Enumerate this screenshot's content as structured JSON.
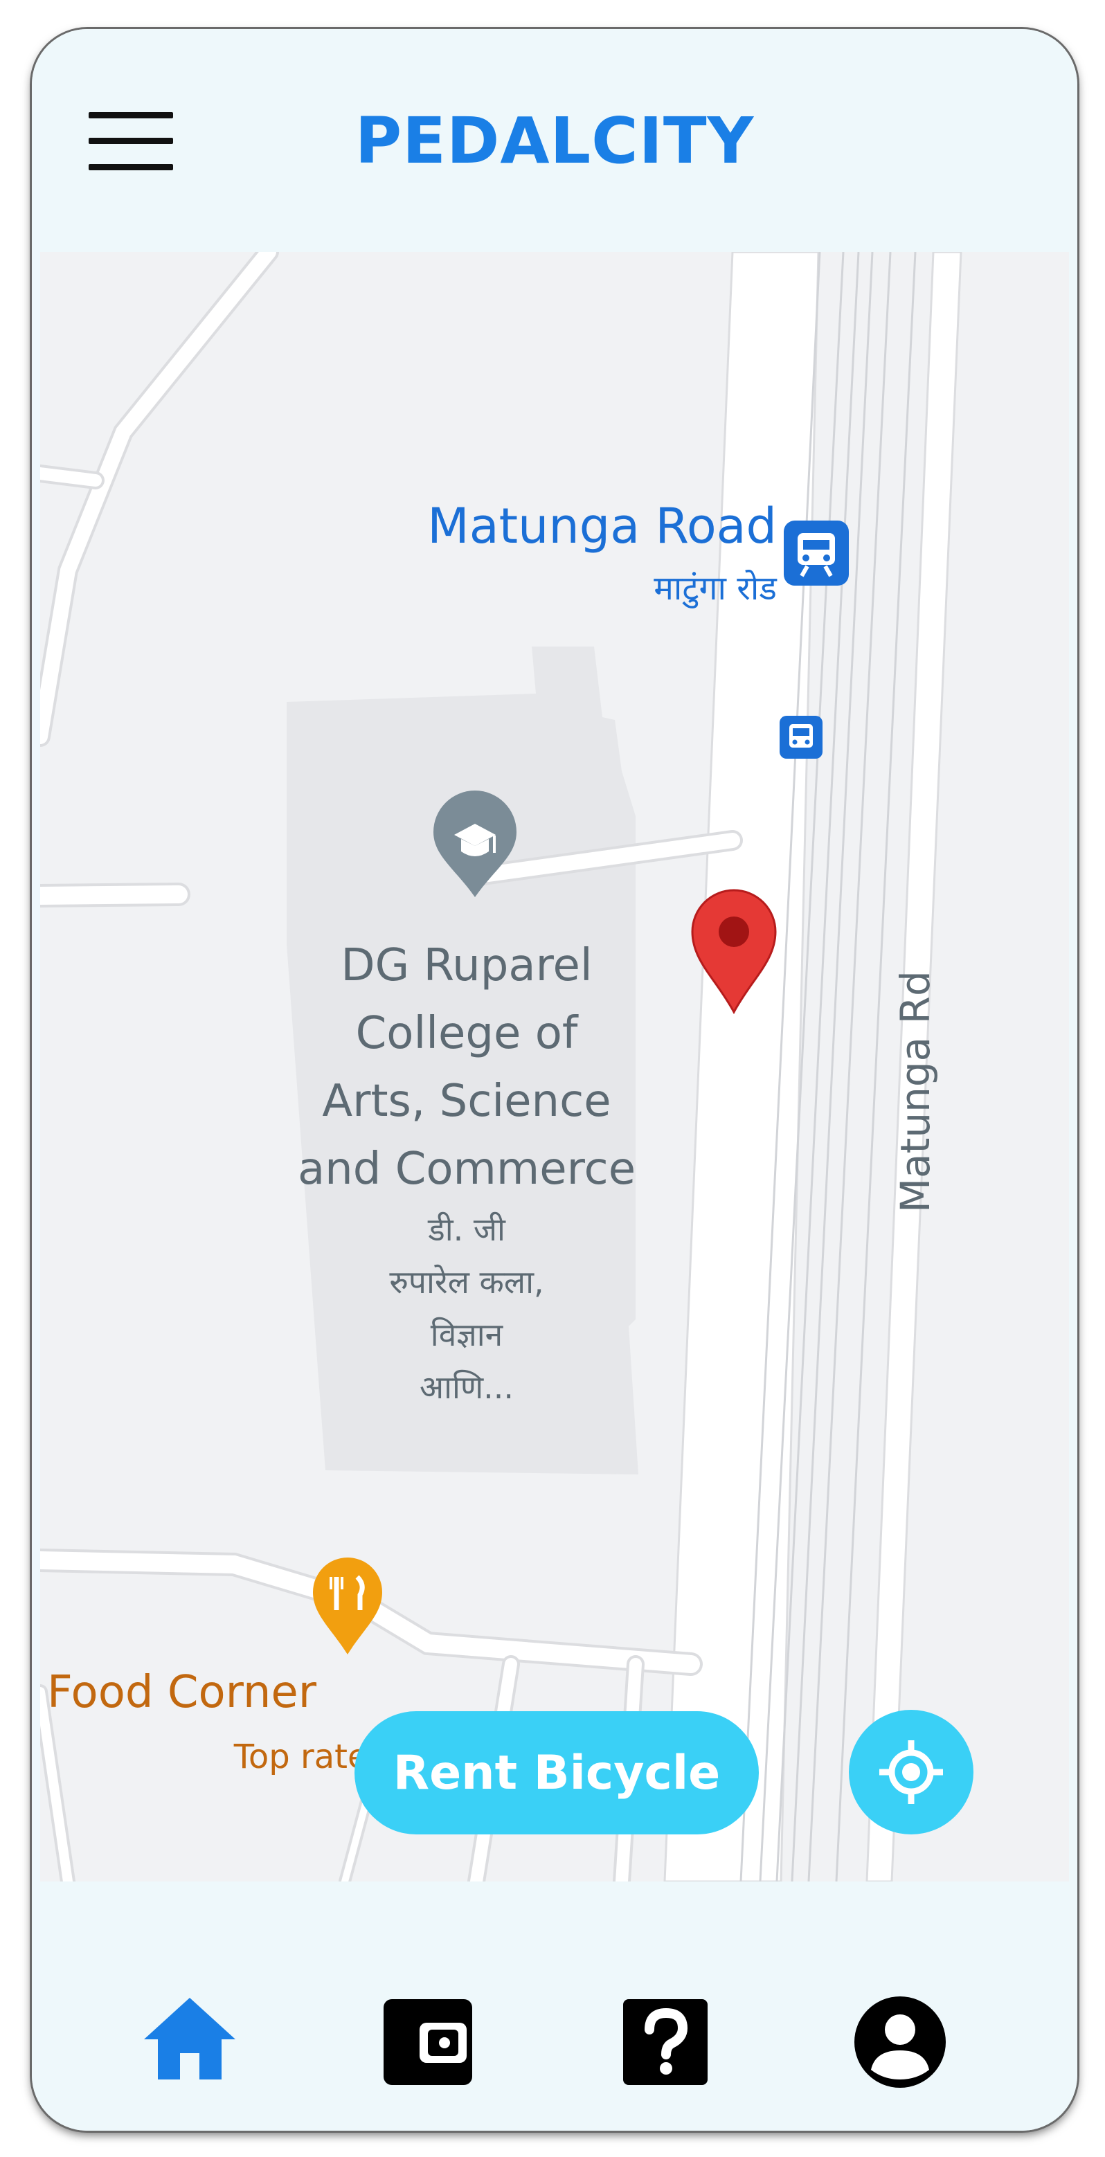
{
  "app": {
    "title": "PEDALCITY"
  },
  "header": {
    "menu_icon": "hamburger-menu-icon"
  },
  "map": {
    "station_name": "Matunga Road",
    "station_name_local": "माटुंगा रोड",
    "college_lines": [
      "DG Ruparel",
      "College of",
      "Arts, Science",
      "and Commerce"
    ],
    "college_lines_local": [
      "डी. जी",
      "रुपारेल कला,",
      "विज्ञान",
      "आणि..."
    ],
    "road_label": "Matunga Rd",
    "restaurant_name": "Food Corner",
    "restaurant_tag": "Top rated",
    "icons": [
      "train-station-icon",
      "bus-stop-icon",
      "school-pin-icon",
      "restaurant-pin-icon",
      "location-pin-icon"
    ]
  },
  "actions": {
    "rent_label": "Rent Bicycle",
    "locate_icon": "my-location-icon"
  },
  "bottom_nav": [
    {
      "name": "home",
      "icon": "home-icon",
      "active": true
    },
    {
      "name": "wallet",
      "icon": "wallet-icon",
      "active": false
    },
    {
      "name": "help",
      "icon": "help-icon",
      "active": false
    },
    {
      "name": "profile",
      "icon": "profile-icon",
      "active": false
    }
  ],
  "colors": {
    "brand": "#1a7fe6",
    "accent": "#3ad0f6",
    "background": "#eef8fb",
    "map_background": "#f1f2f4",
    "pin_red": "#e53935",
    "food_orange": "#c2680f",
    "transit_blue": "#1b6fd6"
  }
}
